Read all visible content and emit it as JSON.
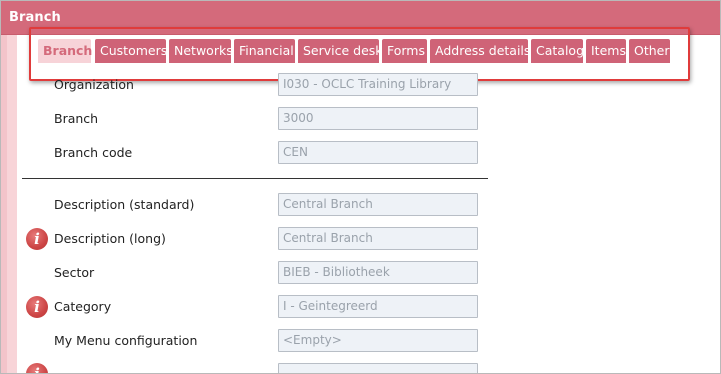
{
  "window": {
    "title": "Branch"
  },
  "tabs": [
    {
      "label": "Branch",
      "active": true
    },
    {
      "label": "Customers"
    },
    {
      "label": "Networks"
    },
    {
      "label": "Financial"
    },
    {
      "label": "Service desk"
    },
    {
      "label": "Forms"
    },
    {
      "label": "Address details"
    },
    {
      "label": "Catalog"
    },
    {
      "label": "Items"
    },
    {
      "label": "Other"
    }
  ],
  "form": {
    "organization": {
      "label": "Organization",
      "value": "I030 - OCLC Training Library"
    },
    "branch": {
      "label": "Branch",
      "value": "3000"
    },
    "branch_code": {
      "label": "Branch code",
      "value": "CEN"
    },
    "description_standard": {
      "label": "Description (standard)",
      "value": "Central Branch"
    },
    "description_long": {
      "label": "Description (long)",
      "value": "Central Branch"
    },
    "sector": {
      "label": "Sector",
      "value": "BIEB - Bibliotheek"
    },
    "category": {
      "label": "Category",
      "value": "I - Geintegreerd"
    },
    "my_menu_configuration": {
      "label": "My Menu configuration",
      "value": "<Empty>"
    }
  },
  "colors": {
    "title_bar": "#d46a7b",
    "tab": "#cf6377",
    "tab_active": "#f7d3d8",
    "highlight": "#e03b3b",
    "info_icon": "#cc4545"
  },
  "icons": {
    "info": "i"
  }
}
